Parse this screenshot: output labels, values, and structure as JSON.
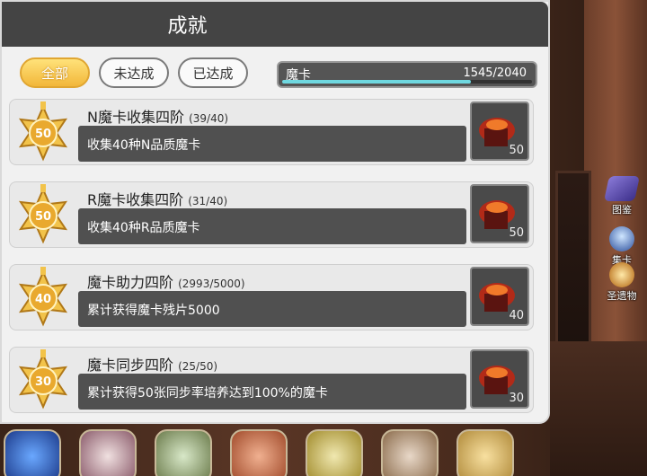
{
  "header": {
    "title": "成就"
  },
  "filters": [
    {
      "label": "全部",
      "active": true
    },
    {
      "label": "未达成",
      "active": false
    },
    {
      "label": "已达成",
      "active": false
    }
  ],
  "progress": {
    "label": "魔卡",
    "value_text": "1545/2040",
    "fraction": 0.757
  },
  "achievements": [
    {
      "medal": "50",
      "title": "N魔卡收集四阶",
      "progress": "(39/40)",
      "desc": "收集40种N品质魔卡",
      "reward_count": "50"
    },
    {
      "medal": "50",
      "title": "R魔卡收集四阶",
      "progress": "(31/40)",
      "desc": "收集40种R品质魔卡",
      "reward_count": "50"
    },
    {
      "medal": "40",
      "title": "魔卡助力四阶",
      "progress": "(2993/5000)",
      "desc": "累计获得魔卡残片5000",
      "reward_count": "40"
    },
    {
      "medal": "30",
      "title": "魔卡同步四阶",
      "progress": "(25/50)",
      "desc": "累计获得50张同步率培养达到100%的魔卡",
      "reward_count": "30"
    }
  ],
  "side_menu": [
    {
      "label": "图鉴",
      "icon": "book-icon"
    },
    {
      "label": "集卡",
      "icon": "card-collect-icon"
    },
    {
      "label": "圣遗物",
      "icon": "relic-icon"
    }
  ],
  "colors": {
    "accent_gold": "#f2b73a",
    "progress_fill": "#6fd8e0",
    "header_bg": "#444444"
  }
}
